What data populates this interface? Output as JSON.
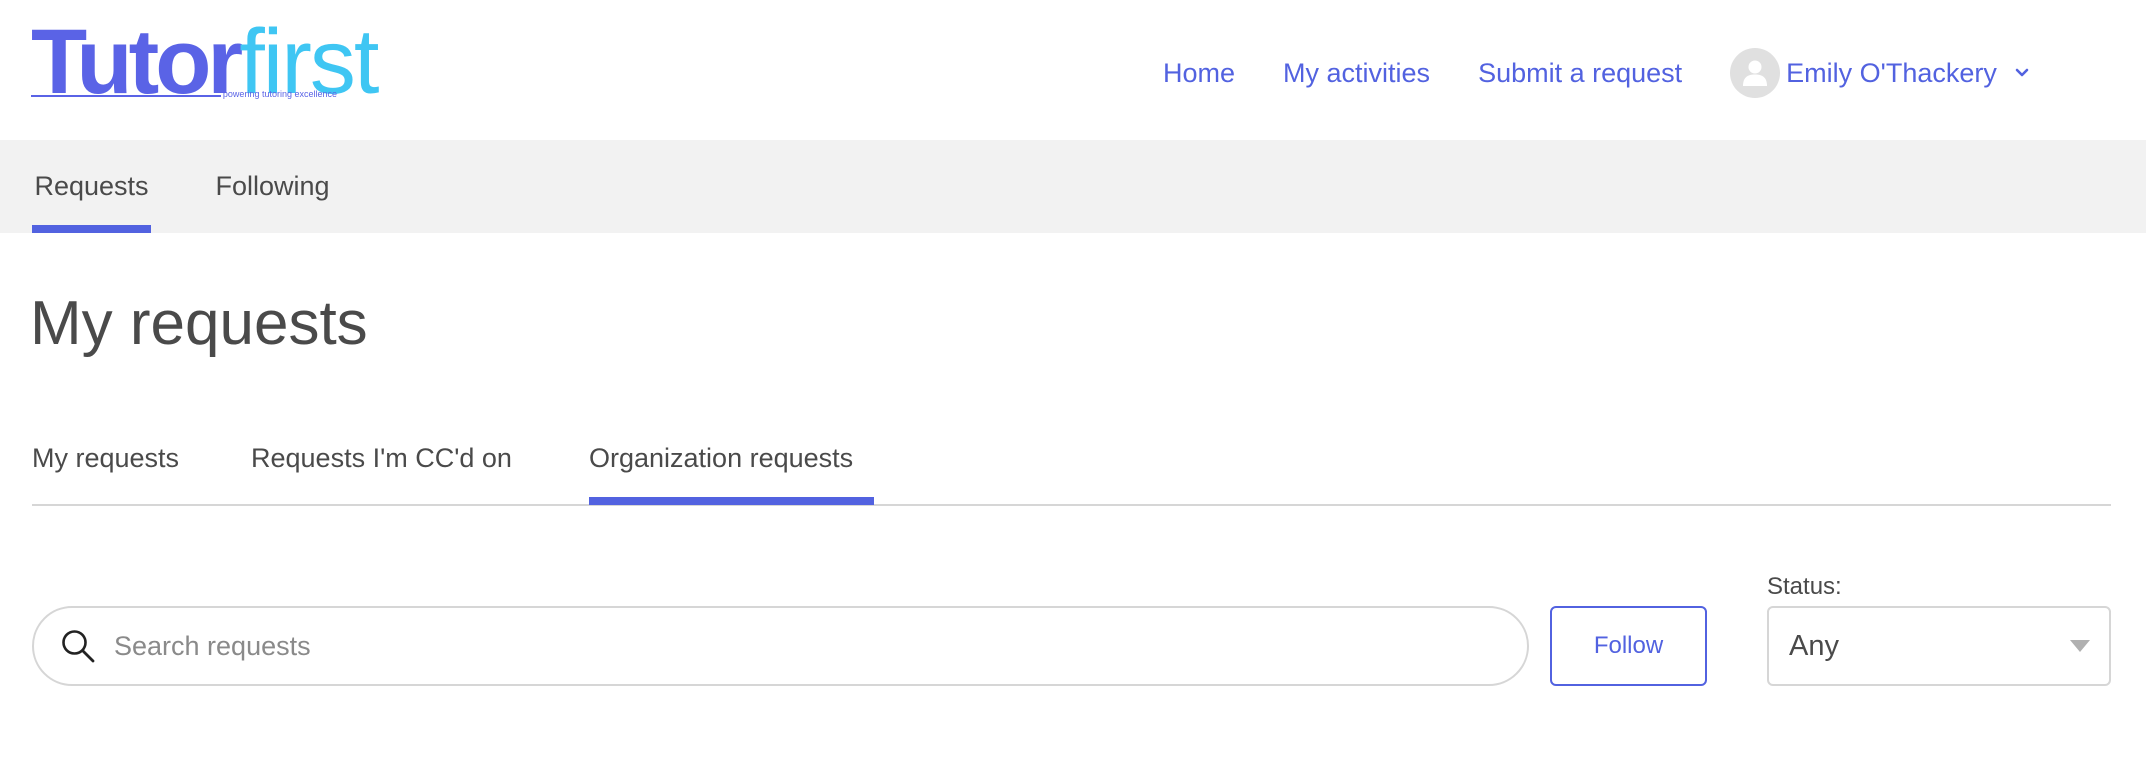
{
  "brand": {
    "logo_part1": "Tutor",
    "logo_part2": "first",
    "tagline": "powering tutoring excellence",
    "primary_color": "#5a63e6",
    "secondary_color": "#3fc6f3"
  },
  "topnav": {
    "home": "Home",
    "activities": "My activities",
    "submit": "Submit a request",
    "user_name": "Emily O'Thackery",
    "avatar_icon": "user-avatar-icon",
    "dropdown_icon": "chevron-down-icon"
  },
  "subnav": {
    "tabs": [
      {
        "label": "Requests",
        "active": true
      },
      {
        "label": "Following",
        "active": false
      }
    ]
  },
  "page": {
    "title": "My requests"
  },
  "request_tabs": [
    {
      "label": "My requests",
      "active": false
    },
    {
      "label": "Requests I'm CC'd on",
      "active": false
    },
    {
      "label": "Organization requests",
      "active": true
    }
  ],
  "search": {
    "placeholder": "Search requests",
    "value": "",
    "icon": "search-icon"
  },
  "follow_button": {
    "label": "Follow"
  },
  "status_filter": {
    "label": "Status:",
    "selected": "Any",
    "icon": "caret-down-icon"
  },
  "colors": {
    "accent": "#5262e0",
    "subnav_bg": "#f2f2f2",
    "border": "#d6d6d6",
    "text": "#4a4a4a"
  }
}
